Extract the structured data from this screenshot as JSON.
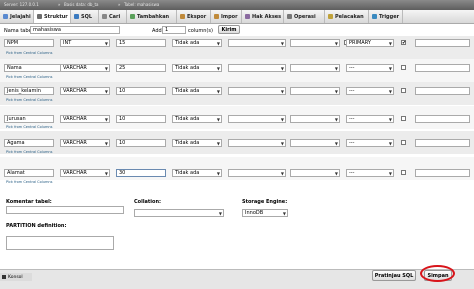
{
  "breadcrumbs": [
    "Server: 127.0.0.1",
    "Basis data: db_ta",
    "Tabel: mahasiswa"
  ],
  "tabs": [
    {
      "label": "Jelajahi",
      "icon": "browse-icon"
    },
    {
      "label": "Struktur",
      "icon": "structure-icon"
    },
    {
      "label": "SQL",
      "icon": "sql-icon"
    },
    {
      "label": "Cari",
      "icon": "search-icon"
    },
    {
      "label": "Tambahkan",
      "icon": "insert-icon"
    },
    {
      "label": "Ekspor",
      "icon": "export-icon"
    },
    {
      "label": "Impor",
      "icon": "import-icon"
    },
    {
      "label": "Hak Akses",
      "icon": "privileges-icon"
    },
    {
      "label": "Operasi",
      "icon": "operations-icon"
    },
    {
      "label": "Pelacakan",
      "icon": "tracking-icon"
    },
    {
      "label": "Trigger",
      "icon": "trigger-icon"
    }
  ],
  "table_form": {
    "name_label": "Nama tabel:",
    "name_value": "mahasiswa",
    "add_label": "Add",
    "add_count": "1",
    "columns_label": "column(s)",
    "go_button": "Kirim"
  },
  "columns": [
    {
      "name": "NPM",
      "type": "INT",
      "length": "15",
      "default": "Tidak ada",
      "index": "PRIMARY",
      "ai": true
    },
    {
      "name": "Nama",
      "type": "VARCHAR",
      "length": "25",
      "default": "Tidak ada",
      "index": "---",
      "ai": false
    },
    {
      "name": "Jenis_kelamin",
      "type": "VARCHAR",
      "length": "10",
      "default": "Tidak ada",
      "index": "---",
      "ai": false
    },
    {
      "name": "Jurusan",
      "type": "VARCHAR",
      "length": "10",
      "default": "Tidak ada",
      "index": "---",
      "ai": false
    },
    {
      "name": "Agama",
      "type": "VARCHAR",
      "length": "10",
      "default": "Tidak ada",
      "index": "---",
      "ai": false
    },
    {
      "name": "Alamat",
      "type": "VARCHAR",
      "length": "30",
      "default": "Tidak ada",
      "index": "---",
      "ai": false
    }
  ],
  "central_link": "Pick from Central Columns",
  "bottom": {
    "comment_label": "Komentar tabel:",
    "collation_label": "Collation:",
    "engine_label": "Storage Engine:",
    "engine_value": "InnoDB",
    "partition_label": "PARTITION definition:"
  },
  "footer": {
    "console_label": "Konsol",
    "preview_button": "Pratinjau SQL",
    "save_button": "Simpan"
  }
}
